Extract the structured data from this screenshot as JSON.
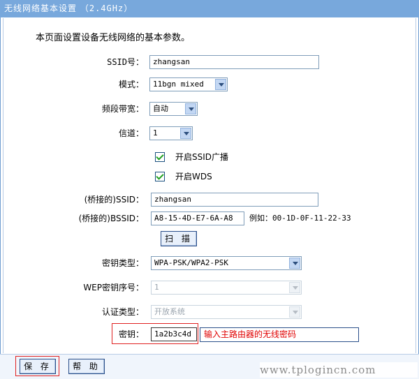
{
  "window": {
    "title": "无线网络基本设置",
    "title_suffix": "（2.4GHz）"
  },
  "intro": "本页面设置设备无线网络的基本参数。",
  "form": {
    "ssid": {
      "label": "SSID号：",
      "value": "zhangsan"
    },
    "mode": {
      "label": "模式：",
      "value": "11bgn mixed"
    },
    "bandwidth": {
      "label": "频段带宽：",
      "value": "自动"
    },
    "channel": {
      "label": "信道：",
      "value": "1"
    },
    "enable_ssid_broadcast": {
      "label": "开启SSID广播",
      "checked": true
    },
    "enable_wds": {
      "label": "开启WDS",
      "checked": true
    },
    "bridged_ssid": {
      "label": "(桥接的)SSID：",
      "value": "zhangsan"
    },
    "bridged_bssid": {
      "label": "(桥接的)BSSID：",
      "value": "A8-15-4D-E7-6A-A8",
      "example": "例如：00-1D-0F-11-22-33"
    },
    "scan_button": "扫 描",
    "key_type": {
      "label": "密钥类型：",
      "value": "WPA-PSK/WPA2-PSK"
    },
    "wep_index": {
      "label": "WEP密钥序号：",
      "value": "1"
    },
    "auth_type": {
      "label": "认证类型：",
      "value": "开放系统"
    },
    "key": {
      "label": "密钥：",
      "value": "1a2b3c4d",
      "hint": "输入主路由器的无线密码"
    }
  },
  "buttons": {
    "save": "保 存",
    "help": "帮 助"
  },
  "watermark": "www.tplogincn.com",
  "colors": {
    "titlebar": "#78a8dc",
    "highlight": "#e02020",
    "hint_text": "#e00000",
    "check": "#21a121"
  }
}
